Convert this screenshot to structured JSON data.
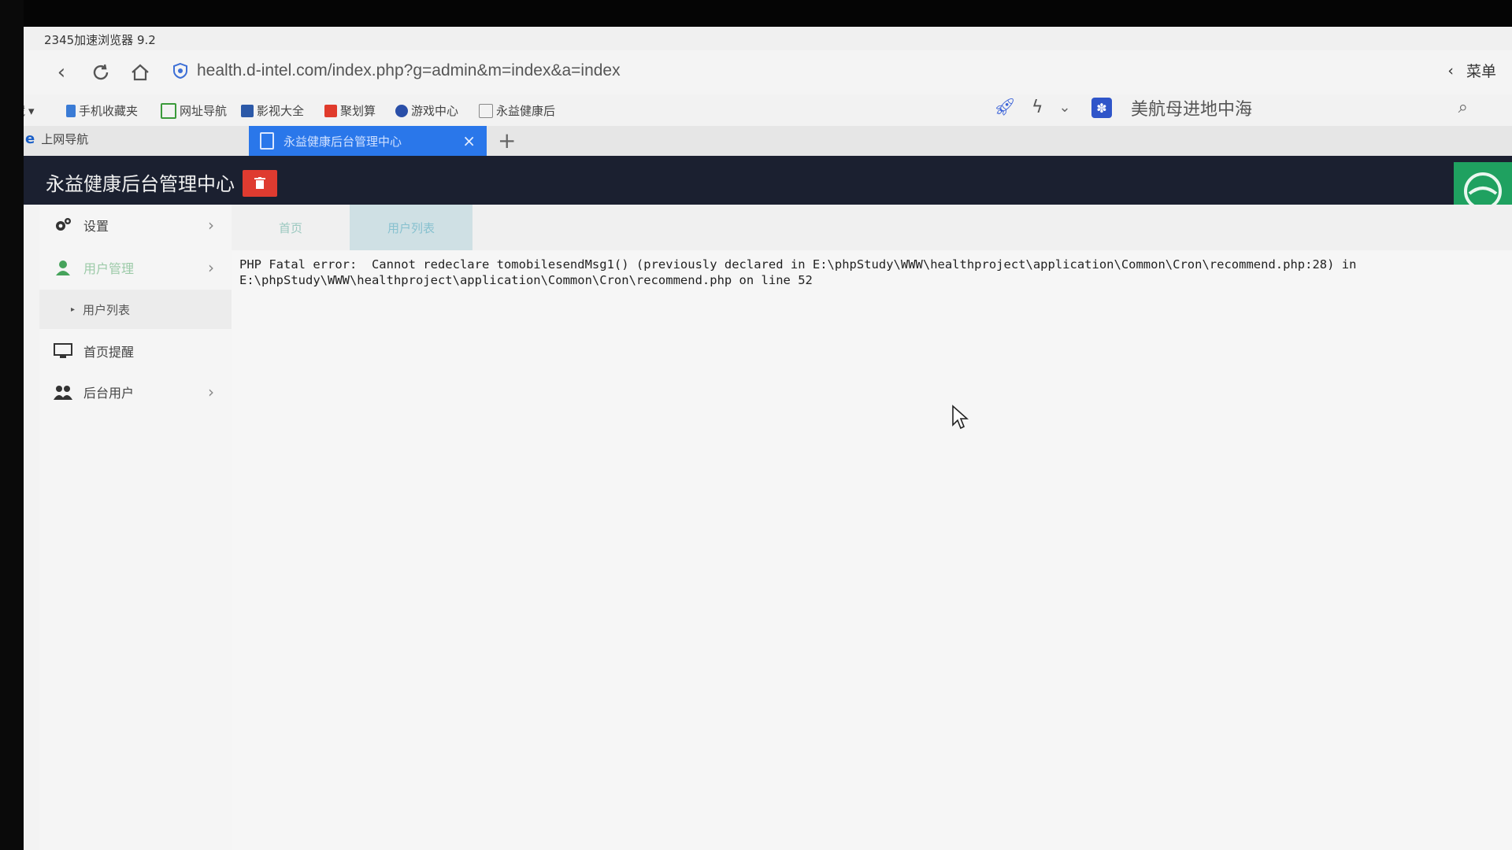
{
  "browser": {
    "title": "2345加速浏览器 9.2",
    "url": "health.d-intel.com/index.php?g=admin&m=index&a=index",
    "menu_label": "菜单",
    "bookmarks": [
      {
        "label": "收藏"
      },
      {
        "label": "手机收藏夹"
      },
      {
        "label": "网址导航"
      },
      {
        "label": "影视大全"
      },
      {
        "label": "聚划算"
      },
      {
        "label": "游戏中心"
      },
      {
        "label": "永益健康后"
      }
    ],
    "search_text": "美航母进地中海",
    "tabs": [
      {
        "label": "上网导航"
      },
      {
        "label": "永益健康后台管理中心",
        "close": "×"
      }
    ],
    "new_tab": "+"
  },
  "app": {
    "title": "永益健康后台管理中心",
    "sidebar": [
      {
        "label": "设置"
      },
      {
        "label": "用户管理"
      },
      {
        "label": "用户列表"
      },
      {
        "label": "首页提醒"
      },
      {
        "label": "后台用户"
      }
    ],
    "content_tabs": [
      {
        "label": "首页"
      },
      {
        "label": "用户列表"
      }
    ],
    "error_message": "PHP Fatal error:  Cannot redeclare tomobilesendMsg1() (previously declared in E:\\phpStudy\\WWW\\healthproject\\application\\Common\\Cron\\recommend.php:28) in\nE:\\phpStudy\\WWW\\healthproject\\application\\Common\\Cron\\recommend.php on line 52"
  },
  "colors": {
    "active_tab": "#2a77ea",
    "header": "#1b2030",
    "delete_button": "#df3b30",
    "logo_green": "#1fa160"
  }
}
